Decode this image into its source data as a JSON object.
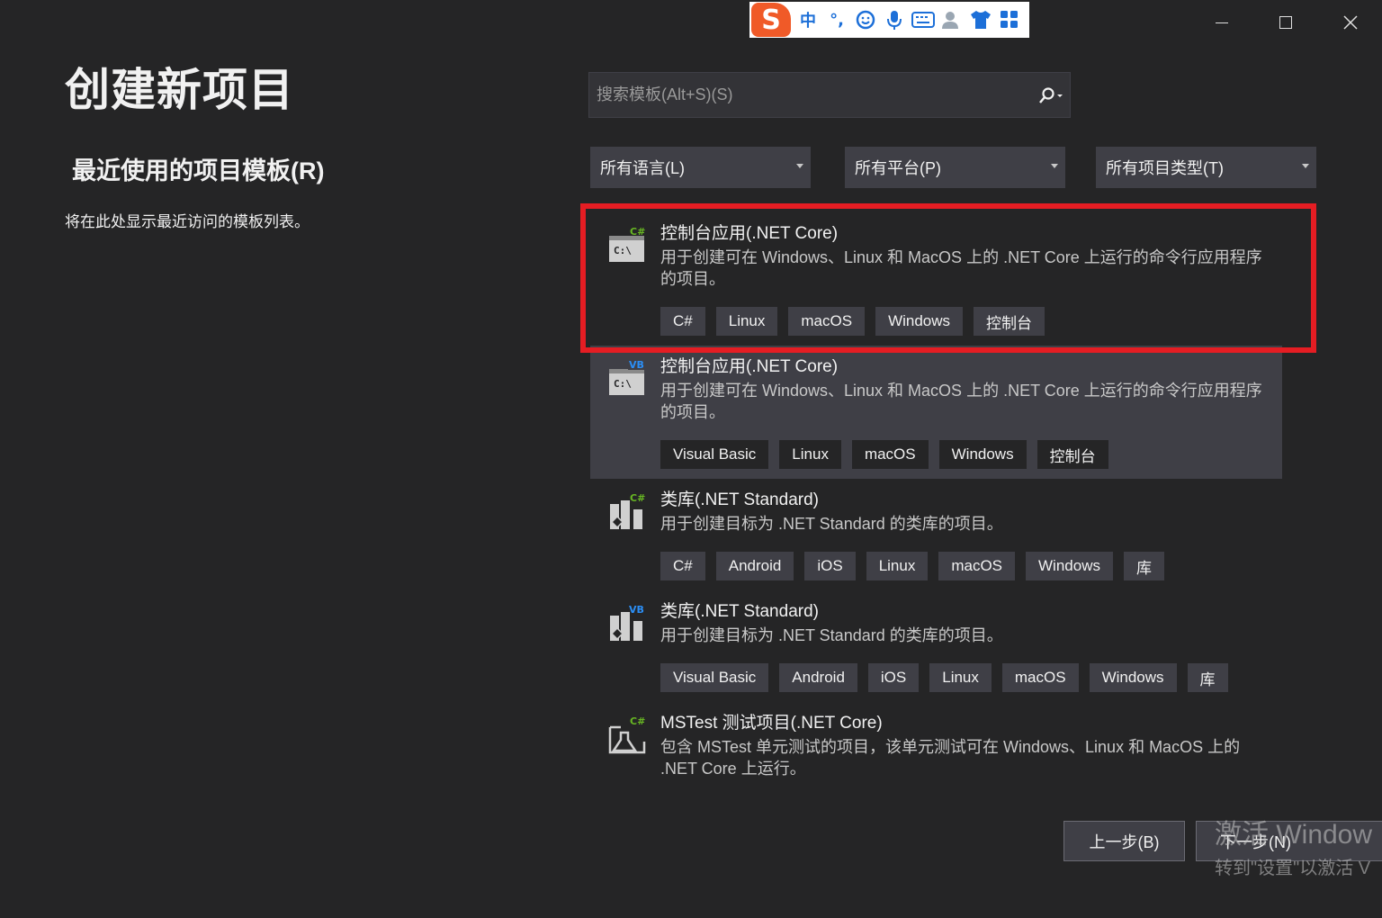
{
  "window": {
    "controls": {
      "minimize": "minimize",
      "maximize": "maximize",
      "close": "close"
    }
  },
  "ime_toolbar": {
    "logo": "S",
    "mode": "中",
    "punct": "°,",
    "icons": [
      "emoji-icon",
      "microphone-icon",
      "keyboard-icon",
      "user-icon",
      "shirt-icon",
      "grid-icon"
    ]
  },
  "page": {
    "title": "创建新项目",
    "recent_title": "最近使用的项目模板(R)",
    "recent_empty": "将在此处显示最近访问的模板列表。"
  },
  "search": {
    "placeholder": "搜索模板(Alt+S)(S)"
  },
  "filters": {
    "language": "所有语言(L)",
    "platform": "所有平台(P)",
    "project_type": "所有项目类型(T)"
  },
  "templates": [
    {
      "name": "控制台应用(.NET Core)",
      "lang_badge": "C#",
      "description": "用于创建可在 Windows、Linux 和 MacOS 上的 .NET Core 上运行的命令行应用程序的项目。",
      "tags": [
        "C#",
        "Linux",
        "macOS",
        "Windows",
        "控制台"
      ]
    },
    {
      "name": "控制台应用(.NET Core)",
      "lang_badge": "VB",
      "description": "用于创建可在 Windows、Linux 和 MacOS 上的 .NET Core 上运行的命令行应用程序的项目。",
      "tags": [
        "Visual Basic",
        "Linux",
        "macOS",
        "Windows",
        "控制台"
      ]
    },
    {
      "name": "类库(.NET Standard)",
      "lang_badge": "C#",
      "description": "用于创建目标为 .NET Standard 的类库的项目。",
      "tags": [
        "C#",
        "Android",
        "iOS",
        "Linux",
        "macOS",
        "Windows",
        "库"
      ]
    },
    {
      "name": "类库(.NET Standard)",
      "lang_badge": "VB",
      "description": "用于创建目标为 .NET Standard 的类库的项目。",
      "tags": [
        "Visual Basic",
        "Android",
        "iOS",
        "Linux",
        "macOS",
        "Windows",
        "库"
      ]
    },
    {
      "name": "MSTest 测试项目(.NET Core)",
      "lang_badge": "C#",
      "description": "包含 MSTest 单元测试的项目，该单元测试可在 Windows、Linux 和 MacOS 上的 .NET Core 上运行。",
      "tags": []
    }
  ],
  "buttons": {
    "back": "上一步(B)",
    "next": "下一步(N)"
  },
  "watermark": {
    "line1": "激活 Window",
    "line2": "转到\"设置\"以激活 V"
  },
  "colors": {
    "background": "#252526",
    "selected": "#3f3f46",
    "highlight": "#e51d23",
    "csharp_badge": "#68b723",
    "vb_badge": "#2b8ef5"
  }
}
